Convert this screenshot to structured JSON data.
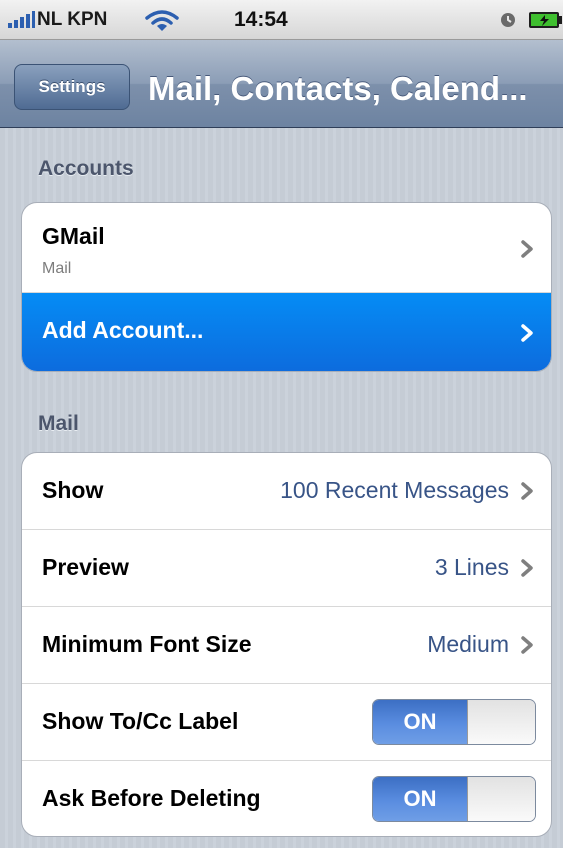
{
  "status_bar": {
    "carrier": "NL KPN",
    "time": "14:54",
    "icons": [
      "signal-icon",
      "wifi-icon",
      "lock-icon",
      "battery-icon"
    ]
  },
  "nav": {
    "back_label": "Settings",
    "title": "Mail, Contacts, Calend..."
  },
  "accounts": {
    "header": "Accounts",
    "items": [
      {
        "title": "GMail",
        "subtitle": "Mail"
      },
      {
        "title": "Add Account..."
      }
    ]
  },
  "mail": {
    "header": "Mail",
    "items": [
      {
        "title": "Show",
        "value": "100 Recent Messages"
      },
      {
        "title": "Preview",
        "value": "3 Lines"
      },
      {
        "title": "Minimum Font Size",
        "value": "Medium"
      },
      {
        "title": "Show To/Cc Label",
        "toggle": "ON"
      },
      {
        "title": "Ask Before Deleting",
        "toggle": "ON"
      }
    ]
  },
  "colors": {
    "selected_row": "#0d6bdd",
    "value_text": "#385487",
    "background": "#c5ccd5"
  }
}
